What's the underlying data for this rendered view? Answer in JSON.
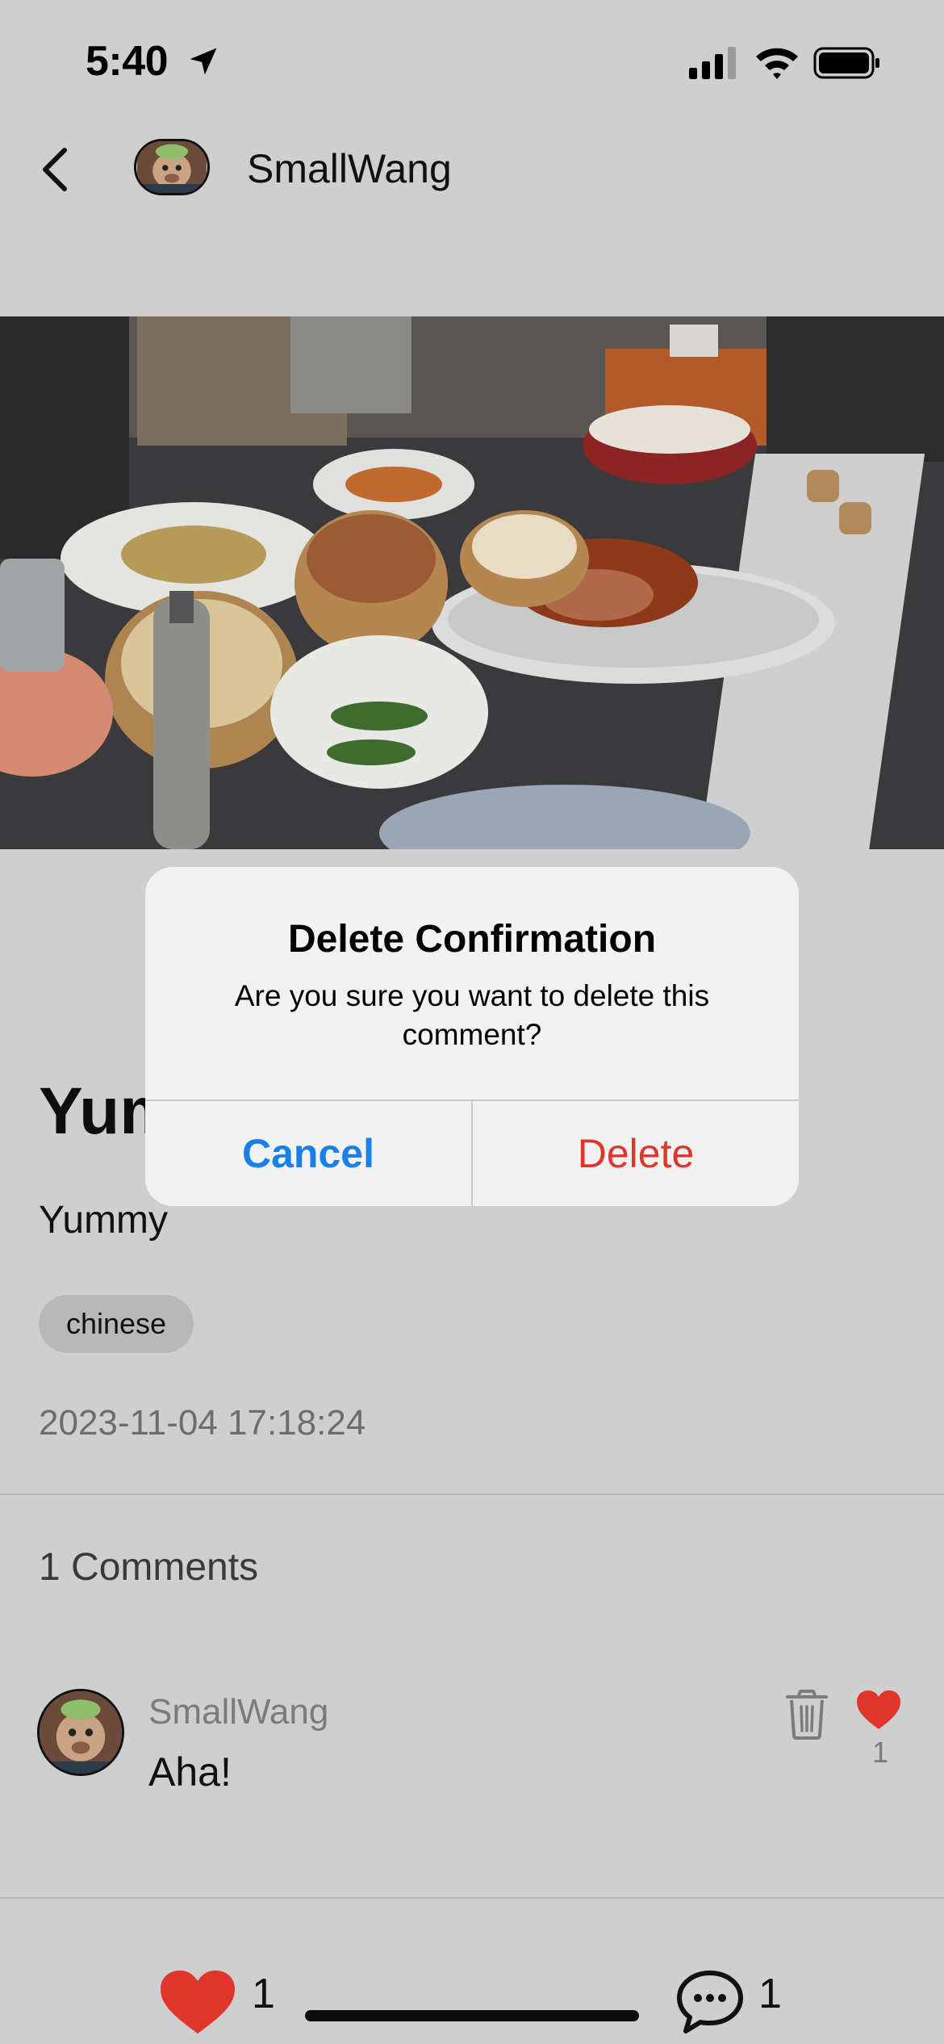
{
  "status_bar": {
    "time": "5:40"
  },
  "header": {
    "username": "SmallWang"
  },
  "post": {
    "title": "Yummy",
    "body": "Yummy",
    "tag": "chinese",
    "date": "2023-11-04 17:18:24"
  },
  "comments": {
    "count_label": "1 Comments",
    "items": [
      {
        "author": "SmallWang",
        "text": "Aha!",
        "likes": "1"
      }
    ]
  },
  "bottom_bar": {
    "like_count": "1",
    "comment_count": "1"
  },
  "dialog": {
    "title": "Delete Confirmation",
    "message": "Are you sure you want to delete this comment?",
    "cancel_label": "Cancel",
    "delete_label": "Delete"
  },
  "colors": {
    "background": "#cfcfcf",
    "like_red": "#e0352b",
    "link_blue": "#1a7fe6",
    "dialog_bg": "#f2f2f2"
  }
}
